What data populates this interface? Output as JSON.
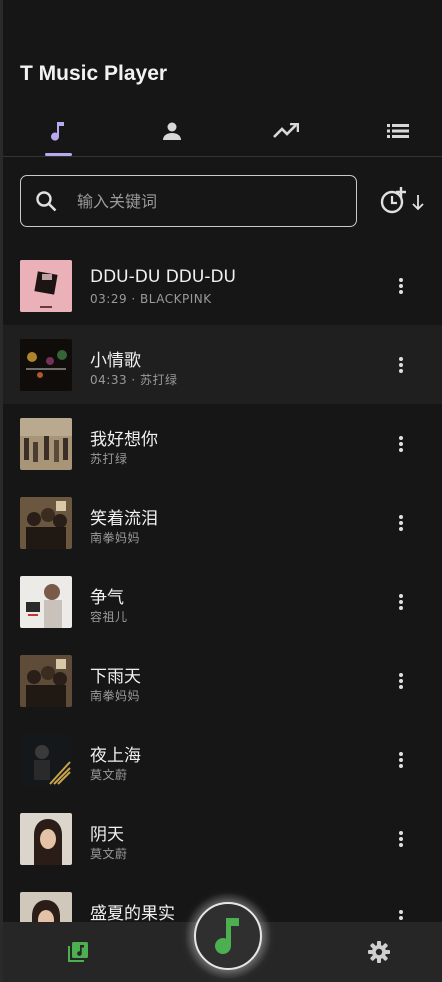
{
  "app": {
    "title": "T Music Player"
  },
  "tabs": [
    {
      "icon": "music-note-icon",
      "active": true
    },
    {
      "icon": "person-icon",
      "active": false
    },
    {
      "icon": "trending-up-icon",
      "active": false
    },
    {
      "icon": "list-icon",
      "active": false
    }
  ],
  "search": {
    "placeholder": "输入关键词",
    "value": ""
  },
  "sort": {
    "icon": "history-sort-icon"
  },
  "songs": [
    {
      "title": "DDU-DU DDU-DU",
      "meta": "03:29 · BLACKPINK",
      "cover_color": "#e7a3ad"
    },
    {
      "title": "小情歌",
      "meta": "04:33 · 苏打绿",
      "cover_color": "#1a1410"
    },
    {
      "title": "我好想你",
      "meta": "苏打绿",
      "cover_color": "#8e7a62"
    },
    {
      "title": "笑着流泪",
      "meta": "南拳妈妈",
      "cover_color": "#5a4632"
    },
    {
      "title": "争气",
      "meta": "容祖儿",
      "cover_color": "#e8e5e0"
    },
    {
      "title": "下雨天",
      "meta": "南拳妈妈",
      "cover_color": "#4e3d2c"
    },
    {
      "title": "夜上海",
      "meta": "莫文蔚",
      "cover_color": "#1c1b1a"
    },
    {
      "title": "阴天",
      "meta": "莫文蔚",
      "cover_color": "#d9d2c8"
    },
    {
      "title": "盛夏的果实",
      "meta": "",
      "cover_color": "#c9c0b4"
    }
  ],
  "colors": {
    "accent": "#b9a8f0",
    "green": "#4caf50",
    "background": "#161616",
    "bar": "#262626"
  },
  "bottom_nav": {
    "library_icon": "music-library-icon",
    "play_icon": "music-note-icon",
    "settings_icon": "gear-icon"
  }
}
